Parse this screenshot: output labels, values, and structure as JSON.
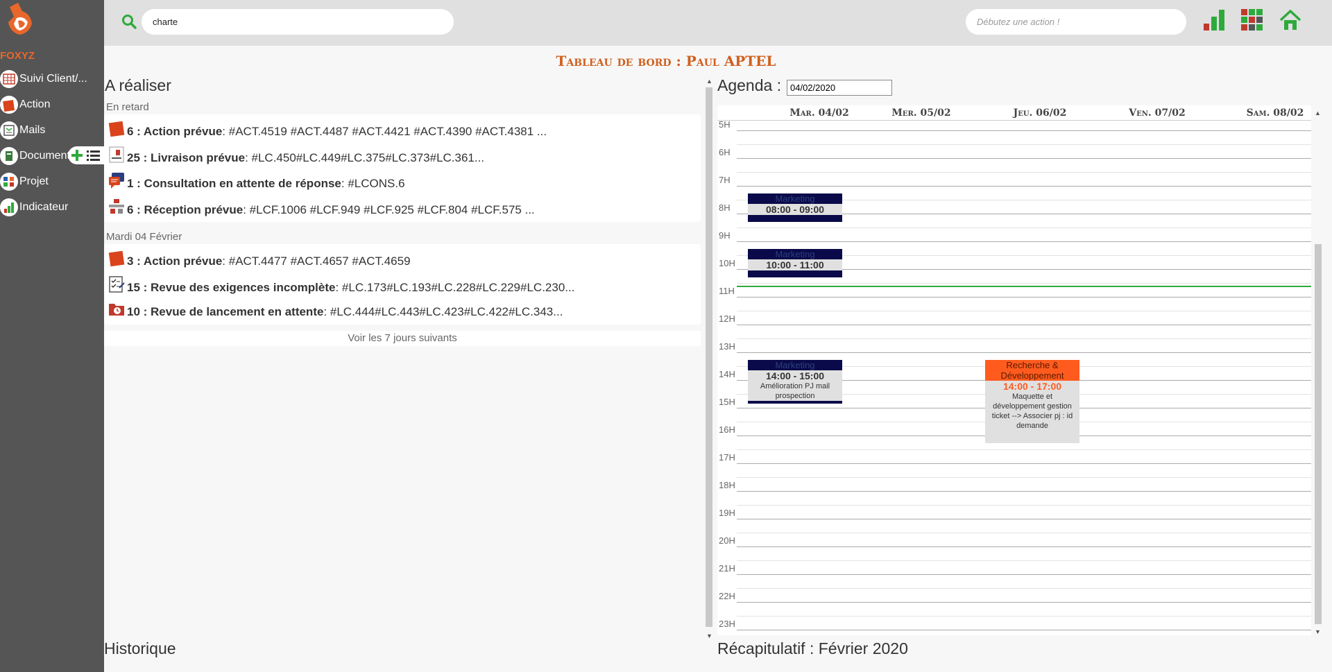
{
  "search": {
    "value": "charte"
  },
  "action_box": {
    "placeholder": "Débutez une action !"
  },
  "brand": "FOXYZ",
  "sidebar": {
    "items": [
      {
        "label": "Suivi Client/..."
      },
      {
        "label": "Action"
      },
      {
        "label": "Mails"
      },
      {
        "label": "Document"
      },
      {
        "label": "Projet"
      },
      {
        "label": "Indicateur"
      }
    ]
  },
  "page_title": "Tableau de bord : Paul APTEL",
  "todo": {
    "heading": "A réaliser",
    "groups": [
      {
        "label": "En retard",
        "rows": [
          {
            "bold": "6 : Action prévue",
            "rest": " : #ACT.4519 #ACT.4487 #ACT.4421 #ACT.4390 #ACT.4381 ..."
          },
          {
            "bold": "25 : Livraison prévue",
            "rest": " : #LC.450#LC.449#LC.375#LC.373#LC.361..."
          },
          {
            "bold": "1 : Consultation en attente de réponse",
            "rest": " : #LCONS.6"
          },
          {
            "bold": "6 : Réception prévue",
            "rest": " : #LCF.1006 #LCF.949 #LCF.925 #LCF.804 #LCF.575 ..."
          }
        ]
      },
      {
        "label": "Mardi 04 Février",
        "rows": [
          {
            "bold": "3 : Action prévue",
            "rest": " : #ACT.4477 #ACT.4657 #ACT.4659"
          },
          {
            "bold": "15 : Revue des exigences incomplète",
            "rest": " : #LC.173#LC.193#LC.228#LC.229#LC.230..."
          },
          {
            "bold": "10 : Revue de lancement en attente",
            "rest": " : #LC.444#LC.443#LC.423#LC.422#LC.343..."
          }
        ]
      }
    ],
    "see_next": "Voir les 7 jours suivants"
  },
  "agenda": {
    "title": "Agenda :",
    "date_value": "04/02/2020",
    "days": [
      "Mar. 04/02",
      "Mer. 05/02",
      "Jeu. 06/02",
      "Ven. 07/02",
      "Sam. 08/02"
    ],
    "hours": [
      "5H",
      "6H",
      "7H",
      "8H",
      "9H",
      "10H",
      "11H",
      "12H",
      "13H",
      "14H",
      "15H",
      "16H",
      "17H",
      "18H",
      "19H",
      "20H",
      "21H",
      "22H",
      "23H"
    ],
    "events": [
      {
        "category": "Marketing",
        "time": "08:00 - 09:00",
        "desc": ""
      },
      {
        "category": "Marketing",
        "time": "10:00 - 11:00",
        "desc": ""
      },
      {
        "category": "Marketing",
        "time": "14:00 - 15:00",
        "desc": "Amélioration PJ mail prospection"
      },
      {
        "category": "Recherche & Développement",
        "time": "14:00 - 17:00",
        "desc": "Maquette et développement gestion ticket --> Associer pj : id demande"
      }
    ]
  },
  "bottom": {
    "historique": "Historique",
    "recap": "Récapitulatif : Février 2020"
  },
  "colors": {
    "brand_orange": "#e8672a",
    "sidebar_bg": "#555555",
    "event_navy": "#0a0a4a",
    "event_orange": "#ff5b1e",
    "now_line": "#2eaa3c",
    "search_green": "#2eaa3c"
  }
}
